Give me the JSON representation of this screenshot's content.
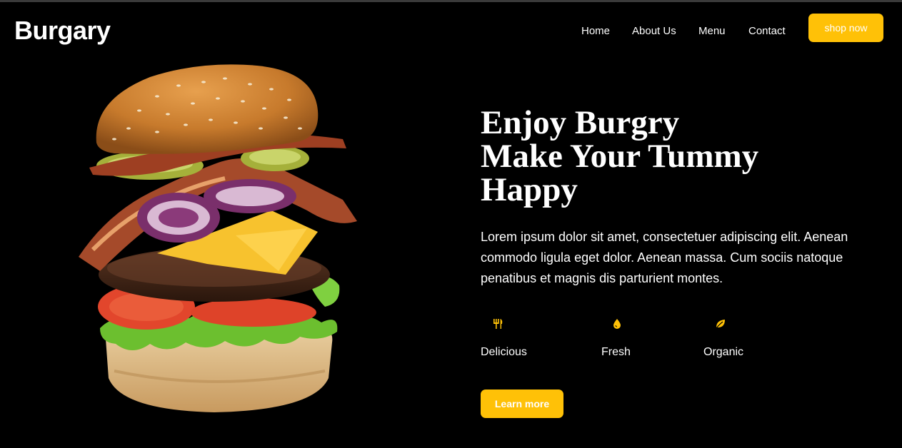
{
  "brand": "Burgary",
  "nav": [
    {
      "label": "Home"
    },
    {
      "label": "About Us"
    },
    {
      "label": "Menu"
    },
    {
      "label": "Contact"
    }
  ],
  "shop_button": "shop now",
  "hero": {
    "line1": "Enjoy Burgry",
    "line2": "Make Your Tummy",
    "line3": "Happy",
    "description": "Lorem ipsum dolor sit amet, consectetuer adipiscing elit. Aenean commodo ligula eget dolor. Aenean massa. Cum sociis natoque penatibus et magnis dis parturient montes.",
    "image_alt": "burger-image",
    "learn_more": "Learn more"
  },
  "features": [
    {
      "label": "Delicious",
      "icon": "utensils-icon"
    },
    {
      "label": "Fresh",
      "icon": "droplet-icon"
    },
    {
      "label": "Organic",
      "icon": "leaf-icon"
    }
  ],
  "colors": {
    "accent": "#ffc107",
    "background": "#000000",
    "text": "#ffffff"
  }
}
